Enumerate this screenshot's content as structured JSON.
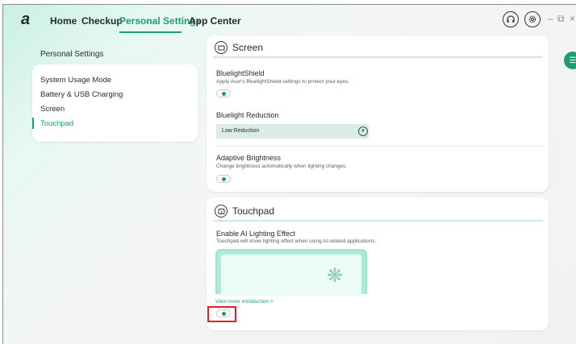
{
  "app": {
    "logo": "a",
    "nav": {
      "tabs": [
        {
          "label": "Home"
        },
        {
          "label": "Checkup"
        },
        {
          "label": "Personal Settings",
          "active": true
        },
        {
          "label": "App Center"
        }
      ]
    },
    "top_icons": [
      "headset-icon",
      "settings-icon"
    ],
    "window_controls": {
      "minimize": "–",
      "restore": "⧉",
      "close": "×"
    }
  },
  "sidebar": {
    "title": "Personal Settings",
    "items": [
      {
        "label": "System Usage Mode"
      },
      {
        "label": "Battery & USB Charging"
      },
      {
        "label": "Screen"
      },
      {
        "label": "Touchpad",
        "active": true
      }
    ]
  },
  "screen_section": {
    "title": "Screen",
    "icon": "screen-icon",
    "bluelight_shield": {
      "label": "BluelightShield",
      "description": "Apply Acer's BluelightShield settings to protect your eyes.",
      "enabled": true
    },
    "bluelight_reduction": {
      "label": "Bluelight Reduction",
      "selected": "Low Reduction"
    },
    "adaptive_brightness": {
      "label": "Adaptive Brightness",
      "description": "Change brightness automatically when lighting changes.",
      "enabled": true
    }
  },
  "touchpad_section": {
    "title": "Touchpad",
    "icon": "touchpad-icon",
    "ai_lighting": {
      "label": "Enable AI Lighting Effect",
      "description": "Touchpad will show lighting effect when using AI-related applications.",
      "link": "View more introduction >",
      "enabled": true
    }
  },
  "colors": {
    "accent": "#1a9e74",
    "highlight": "#d8232a"
  }
}
